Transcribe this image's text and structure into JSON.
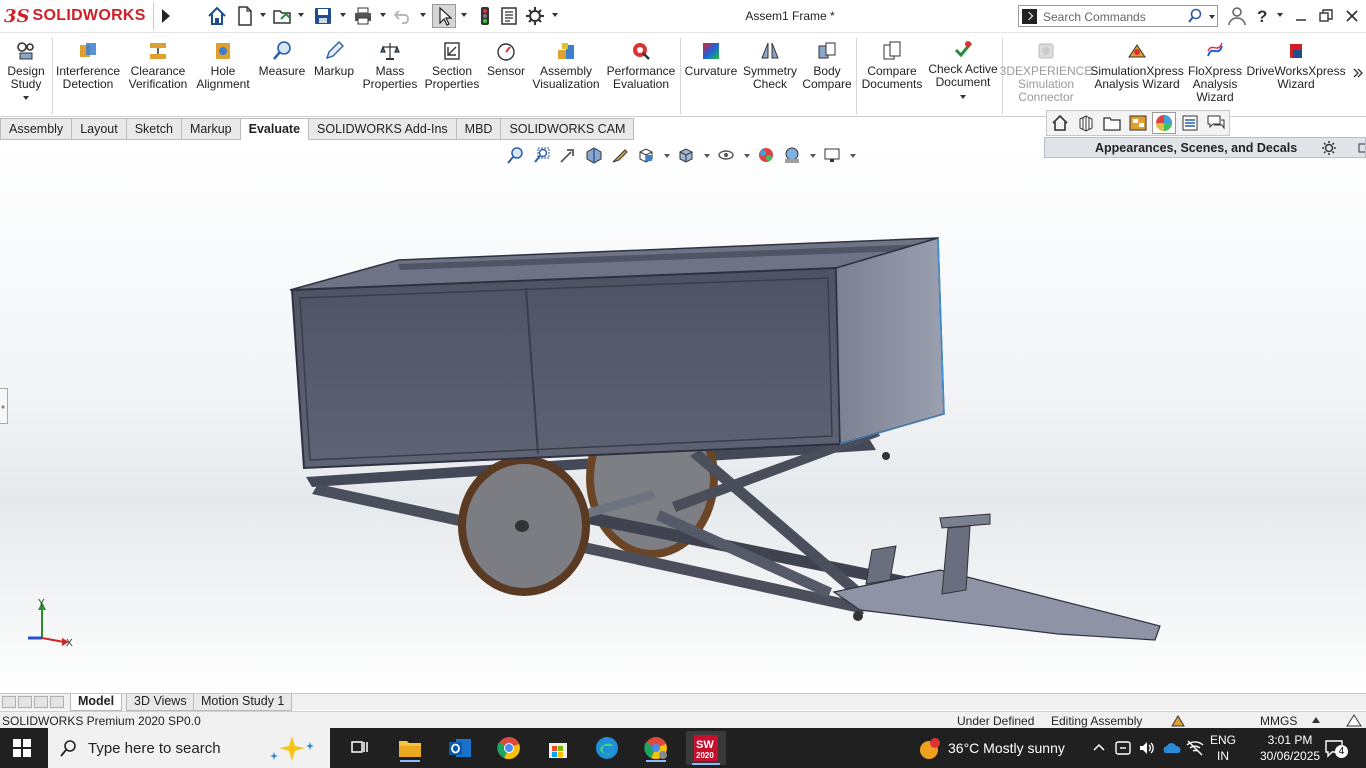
{
  "app": {
    "brand_ds": "3S",
    "brand_name": "SOLIDWORKS",
    "document_title": "Assem1 Frame *"
  },
  "search": {
    "placeholder": "Search Commands"
  },
  "ribbon": {
    "buttons": [
      {
        "label": "Design\nStudy",
        "icon": "design-study-icon"
      },
      {
        "label": "Interference\nDetection",
        "icon": "interference-icon"
      },
      {
        "label": "Clearance\nVerification",
        "icon": "clearance-icon"
      },
      {
        "label": "Hole\nAlignment",
        "icon": "hole-alignment-icon"
      },
      {
        "label": "Measure",
        "icon": "measure-icon"
      },
      {
        "label": "Markup",
        "icon": "markup-icon"
      },
      {
        "label": "Mass\nProperties",
        "icon": "mass-properties-icon"
      },
      {
        "label": "Section\nProperties",
        "icon": "section-properties-icon"
      },
      {
        "label": "Sensor",
        "icon": "sensor-icon"
      },
      {
        "label": "Assembly\nVisualization",
        "icon": "assembly-visualization-icon"
      },
      {
        "label": "Performance\nEvaluation",
        "icon": "performance-icon"
      },
      {
        "label": "Curvature",
        "icon": "curvature-icon"
      },
      {
        "label": "Symmetry\nCheck",
        "icon": "symmetry-icon"
      },
      {
        "label": "Body\nCompare",
        "icon": "body-compare-icon"
      },
      {
        "label": "Compare\nDocuments",
        "icon": "compare-docs-icon"
      },
      {
        "label": "Check Active\nDocument",
        "icon": "check-document-icon"
      },
      {
        "label": "3DEXPERIENCE\nSimulation\nConnector",
        "icon": "3dexperience-icon"
      },
      {
        "label": "SimulationXpress\nAnalysis Wizard",
        "icon": "simulationxpress-icon"
      },
      {
        "label": "FloXpress\nAnalysis\nWizard",
        "icon": "floxpress-icon"
      },
      {
        "label": "DriveWorksXpress\nWizard",
        "icon": "driveworks-icon"
      }
    ]
  },
  "command_tabs": [
    "Assembly",
    "Layout",
    "Sketch",
    "Markup",
    "Evaluate",
    "SOLIDWORKS Add-Ins",
    "MBD",
    "SOLIDWORKS CAM"
  ],
  "active_command_tab": "Evaluate",
  "task_pane": {
    "title": "Appearances, Scenes, and Decals"
  },
  "triad": {
    "x": "X",
    "y": "Y"
  },
  "bottom_tabs": [
    "Model",
    "3D Views",
    "Motion Study 1"
  ],
  "status": {
    "product": "SOLIDWORKS Premium 2020 SP0.0",
    "definition": "Under Defined",
    "mode": "Editing Assembly",
    "units": "MMGS"
  },
  "taskbar": {
    "search_placeholder": "Type here to search",
    "weather": "36°C  Mostly sunny",
    "lang_line1": "ENG",
    "lang_line2": "IN",
    "time": "3:01 PM",
    "date": "30/06/2025",
    "notifications": "4",
    "sw_badge": "2020"
  },
  "colors": {
    "brand_red": "#d21f26",
    "body_panel": "#5b6070",
    "frame_tube": "#4a4e5a",
    "tyre": "#5a3a22",
    "wheel_disc": "#7b7d82",
    "plate": "#8e94a6"
  }
}
